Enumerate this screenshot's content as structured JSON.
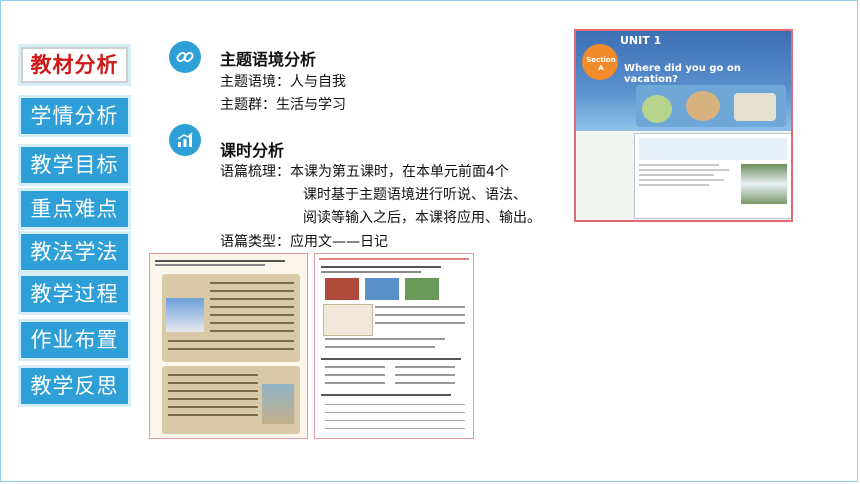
{
  "nav": {
    "items": [
      {
        "label": "教材分析",
        "active": true
      },
      {
        "label": "学情分析",
        "active": false
      },
      {
        "label": "教学目标",
        "active": false
      },
      {
        "label": "重点难点",
        "active": false
      },
      {
        "label": "教法学法",
        "active": false
      },
      {
        "label": "教学过程",
        "active": false
      },
      {
        "label": "作业布置",
        "active": false
      },
      {
        "label": "教学反思",
        "active": false
      }
    ]
  },
  "section1": {
    "icon": "link-icon",
    "title": "主题语境分析",
    "line1": "主题语境：人与自我",
    "line2": "主题群：生活与学习"
  },
  "section2": {
    "icon": "bar-chart-icon",
    "title": "课时分析",
    "line1": "语篇梳理：本课为第五课时，在本单元前面4个",
    "line2": "课时基于主题语境进行听说、语法、",
    "line3": "阅读等输入之后，本课将应用、输出。",
    "line4": "语篇类型：应用文——日记"
  },
  "textbook_top": {
    "unit": "UNIT 1",
    "section": "Section A",
    "heading": "Where did you go on vacation?"
  },
  "colors": {
    "accent": "#2f9fd8",
    "active_text": "#d01818"
  }
}
